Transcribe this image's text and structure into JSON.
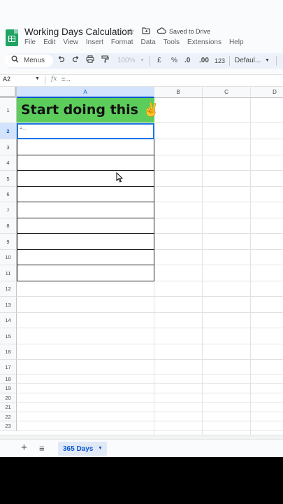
{
  "doc": {
    "title": "Working Days Calculation",
    "saved_status": "Saved to Drive"
  },
  "menu": [
    "File",
    "Edit",
    "View",
    "Insert",
    "Format",
    "Data",
    "Tools",
    "Extensions",
    "Help"
  ],
  "toolbar": {
    "search_label": "Menus",
    "zoom": "100%",
    "currency": "£",
    "percent": "%",
    "decrease_decimals": ".0",
    "increase_decimals": ".00",
    "number_format": "123",
    "font": "Defaul..."
  },
  "formula_bar": {
    "cell_ref": "A2",
    "fx": "fx",
    "value": "=..."
  },
  "columns": [
    "A",
    "B",
    "C",
    "D"
  ],
  "rows": [
    "1",
    "2",
    "3",
    "4",
    "5",
    "6",
    "7",
    "8",
    "9",
    "10",
    "11",
    "12",
    "13",
    "14",
    "15",
    "16",
    "17",
    "18",
    "19",
    "20",
    "21",
    "22",
    "23"
  ],
  "cells": {
    "A1": "Start doing this ✌️",
    "A2": "=..."
  },
  "sheets": {
    "active_tab": "365 Days"
  },
  "colors": {
    "banner": "#5ccd5a",
    "accent": "#0b57d0"
  }
}
